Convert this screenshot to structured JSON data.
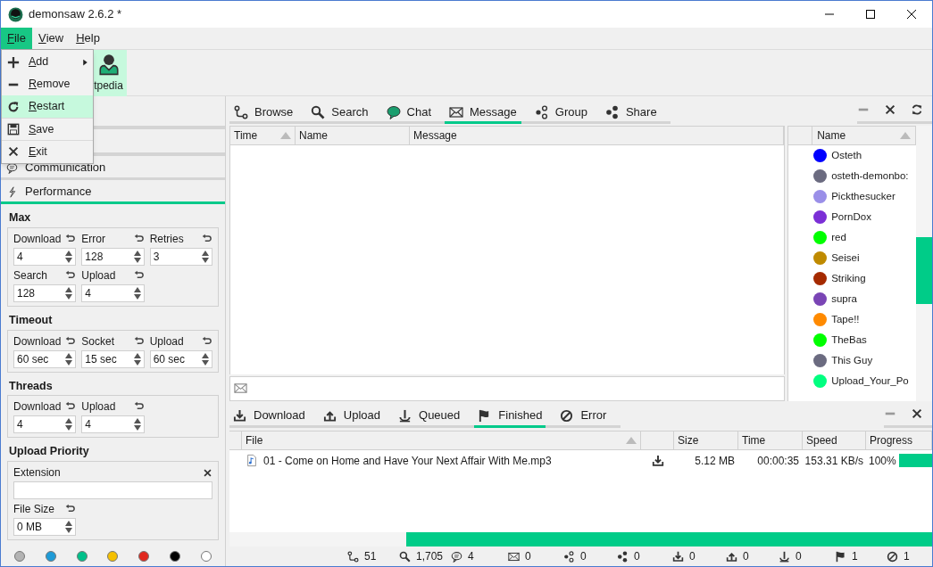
{
  "window": {
    "title": "demonsaw 2.6.2 *"
  },
  "menu_bar": [
    {
      "label": "File",
      "selected": true
    },
    {
      "label": "View",
      "selected": false
    },
    {
      "label": "Help",
      "selected": false
    }
  ],
  "toolbar": [
    {
      "label": "tpedia",
      "selected": true
    }
  ],
  "file_menu": [
    {
      "label": "Add",
      "submenu": true,
      "selected": false
    },
    {
      "label": "Remove",
      "submenu": false,
      "selected": false
    },
    {
      "label": "Restart",
      "submenu": false,
      "selected": true
    },
    {
      "label": "Save",
      "submenu": false,
      "selected": false
    },
    {
      "label": "Exit",
      "submenu": false,
      "selected": false
    }
  ],
  "sidebar": {
    "sections": [
      {
        "label": "Communication",
        "selected": false
      },
      {
        "label": "Performance",
        "selected": true
      }
    ],
    "groups": [
      {
        "title": "Max",
        "fields": [
          {
            "kind": "spin",
            "label": "Download",
            "value": "4"
          },
          {
            "kind": "spin",
            "label": "Error",
            "value": "128"
          },
          {
            "kind": "spin",
            "label": "Retries",
            "value": "3"
          },
          {
            "kind": "spin",
            "label": "Search",
            "value": "128"
          },
          {
            "kind": "spin",
            "label": "Upload",
            "value": "4"
          }
        ]
      },
      {
        "title": "Timeout",
        "fields": [
          {
            "kind": "spin",
            "label": "Download",
            "value": "60 sec"
          },
          {
            "kind": "spin",
            "label": "Socket",
            "value": "15 sec"
          },
          {
            "kind": "spin",
            "label": "Upload",
            "value": "60 sec"
          }
        ]
      },
      {
        "title": "Threads",
        "fields": [
          {
            "kind": "spin",
            "label": "Download",
            "value": "4"
          },
          {
            "kind": "spin",
            "label": "Upload",
            "value": "4"
          }
        ]
      },
      {
        "title": "Upload Priority",
        "fields": [
          {
            "kind": "text",
            "label": "Extension"
          },
          {
            "kind": "spin",
            "label": "File Size",
            "value": "0 MB"
          }
        ]
      }
    ],
    "swatches": [
      {
        "color": "#b3b3b3"
      },
      {
        "color": "#1e9bd7"
      },
      {
        "color": "#00c08a"
      },
      {
        "color": "#f5c000"
      },
      {
        "color": "#e0281e"
      },
      {
        "color": "#000000"
      },
      {
        "color": "#ffffff"
      }
    ]
  },
  "tabs": [
    {
      "label": "Browse",
      "selected": false
    },
    {
      "label": "Search",
      "selected": false
    },
    {
      "label": "Chat",
      "selected": false
    },
    {
      "label": "Message",
      "selected": true
    },
    {
      "label": "Group",
      "selected": false
    },
    {
      "label": "Share",
      "selected": false
    }
  ],
  "messages": {
    "columns": [
      "Time",
      "Name",
      "Message"
    ]
  },
  "users": {
    "columns": [
      "Name"
    ],
    "rows": [
      {
        "name": "Osteth",
        "color": "#0000ff"
      },
      {
        "name": "osteth-demonbo:",
        "color": "#6b6b80"
      },
      {
        "name": "Pickthesucker",
        "color": "#9a8fe8"
      },
      {
        "name": "PornDox",
        "color": "#7b2fd6"
      },
      {
        "name": "red",
        "color": "#00ff00"
      },
      {
        "name": "Seisei",
        "color": "#bf8a00"
      },
      {
        "name": "Striking",
        "color": "#a52a00"
      },
      {
        "name": "supra",
        "color": "#7a45b5"
      },
      {
        "name": "Tape!!",
        "color": "#ff8a00"
      },
      {
        "name": "TheBas",
        "color": "#00ff00"
      },
      {
        "name": "This Guy",
        "color": "#6b6b80"
      },
      {
        "name": "Upload_Your_Po",
        "color": "#00ff80"
      }
    ]
  },
  "transfer_tabs": [
    {
      "label": "Download",
      "selected": false
    },
    {
      "label": "Upload",
      "selected": false
    },
    {
      "label": "Queued",
      "selected": false
    },
    {
      "label": "Finished",
      "selected": true
    },
    {
      "label": "Error",
      "selected": false
    }
  ],
  "transfers": {
    "columns": [
      "File",
      "Size",
      "Time",
      "Speed",
      "Progress"
    ],
    "rows": [
      {
        "file": "01 - Come on Home and Have Your Next Affair With Me.mp3",
        "size": "5.12 MB",
        "time": "00:00:35",
        "speed": "153.31 KB/s",
        "progress": "100%",
        "level": 1
      }
    ]
  },
  "status_bar": [
    {
      "value": "51"
    },
    {
      "value": "1,705"
    },
    {
      "value": "4"
    },
    {
      "value": "0"
    },
    {
      "value": "0"
    },
    {
      "value": "0"
    },
    {
      "value": "0"
    },
    {
      "value": "0"
    },
    {
      "value": "0"
    },
    {
      "value": "1"
    },
    {
      "value": "1"
    }
  ]
}
